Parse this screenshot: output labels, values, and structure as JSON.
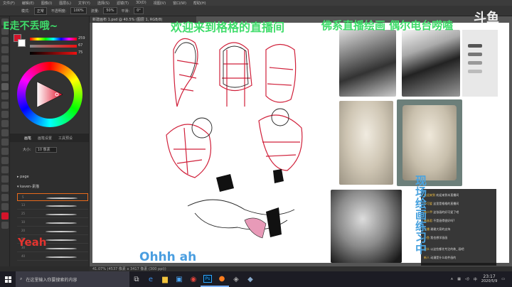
{
  "menubar": {
    "items": [
      "文件(F)",
      "编辑(E)",
      "图像(I)",
      "图层(L)",
      "文字(Y)",
      "选择(S)",
      "滤镜(T)",
      "3D(D)",
      "视图(V)",
      "窗口(W)",
      "帮助(H)"
    ]
  },
  "optionsbar": {
    "mode_label": "模式:",
    "mode_value": "正常",
    "opacity_label": "不透明度:",
    "opacity_value": "100%",
    "flow_label": "流量:",
    "flow_value": "50%",
    "smooth_label": "平滑:",
    "angle_value": "0°"
  },
  "color_panel": {
    "slider_values": [
      "259",
      "67",
      "75"
    ],
    "fg_color": "#d4142a",
    "bg_color": "#ffffff"
  },
  "brush_panel": {
    "tabs": [
      "画笔",
      "画笔设置",
      "工具预设"
    ],
    "size_label": "大小:",
    "size_value": "10 像素",
    "folders": [
      "page",
      "kaven-素描"
    ],
    "brush_numbers": [
      "5",
      "13",
      "25",
      "10",
      "20",
      "50",
      "30",
      "40",
      "8"
    ]
  },
  "document": {
    "tab_title": "新建画布 1.psd @ 40.5% (图层 1, RGB/8)",
    "status_text": "41.07%   (4537 像素 x 3417 像素 (300 ppi))"
  },
  "overlays": {
    "left_banner": "E走不丢哦~",
    "welcome": "欢迎来到格格的直播间",
    "buddhist": "佛系直播绘画 偶尔电台唠嗑",
    "practice": "现场绘画练习中",
    "ohhh": "Ohhh ah",
    "yeah": "Yeah",
    "logo": "斗鱼"
  },
  "chat": {
    "lines": [
      {
        "user": "欢迎来到",
        "text": "欢迎来到本直播间"
      },
      {
        "user": "小可爱",
        "text": "这里是格格的直播间"
      },
      {
        "user": "路人甲",
        "text": "这张画的好可爱了吧"
      },
      {
        "user": "画画君",
        "text": "不是画得很好吗?"
      },
      {
        "user": "主播",
        "text": "谢谢大家的支持"
      },
      {
        "user": "小鱼",
        "text": "我也想学画画"
      },
      {
        "user": "观众",
        "text": "以这些都先专注的练_ 画吧"
      },
      {
        "user": "新人",
        "text": "动漫是什么软件画的"
      }
    ]
  },
  "taskbar": {
    "search_placeholder": "在这里输入你要搜索的内容",
    "apps": [
      "edge-icon",
      "folder-icon",
      "store-icon",
      "chrome-icon",
      "photoshop-icon",
      "douyu-icon",
      "media-icon",
      "app-icon"
    ],
    "time": "23:17",
    "date": "2020/5/9",
    "ime": "中"
  }
}
